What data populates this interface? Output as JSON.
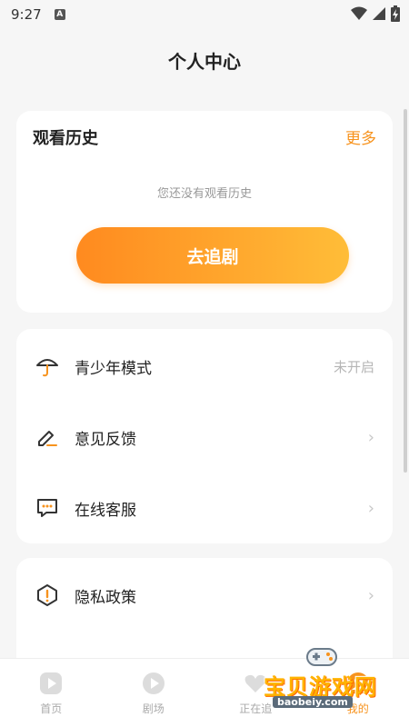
{
  "status": {
    "time": "9:27",
    "badge": "A"
  },
  "page": {
    "title": "个人中心"
  },
  "history": {
    "title": "观看历史",
    "more": "更多",
    "empty_text": "您还没有观看历史",
    "cta": "去追剧"
  },
  "menu": {
    "teen_mode": {
      "label": "青少年模式",
      "value": "未开启",
      "icon": "umbrella-icon"
    },
    "feedback": {
      "label": "意见反馈",
      "icon": "pencil-icon"
    },
    "service": {
      "label": "在线客服",
      "icon": "chat-bubble-icon"
    },
    "privacy": {
      "label": "隐私政策",
      "icon": "exclamation-shield-icon"
    },
    "chevron": "›"
  },
  "tabs": [
    {
      "label": "首页",
      "icon": "play-icon"
    },
    {
      "label": "剧场",
      "icon": "play-icon"
    },
    {
      "label": "正在追",
      "icon": "heart-icon"
    },
    {
      "label": "我的",
      "icon": "user-icon"
    }
  ],
  "watermark": {
    "title": "宝贝游戏网",
    "domain": "baobeiy.com"
  },
  "colors": {
    "accent": "#f7931e",
    "gradient_start": "#ff8a1f",
    "gradient_end": "#ffbd38"
  }
}
